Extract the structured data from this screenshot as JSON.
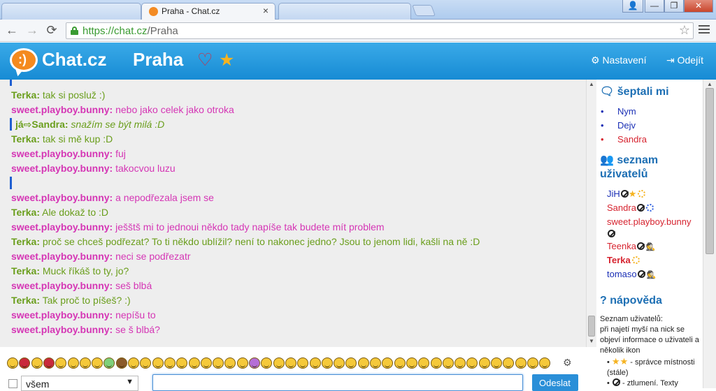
{
  "browser": {
    "tab_title": "Praha - Chat.cz",
    "tab_close": "×",
    "url_scheme": "https://",
    "url_host": "chat.cz",
    "url_path": "/Praha",
    "back": "←",
    "forward": "→",
    "reload": "⟳",
    "bookmark_star": "☆",
    "win_user": "👤",
    "win_min": "—",
    "win_max": "❐",
    "win_close": "✕"
  },
  "header": {
    "logo_face": ":)",
    "brand": "Chat.cz",
    "room": "Praha",
    "heart": "♡",
    "star": "★",
    "settings": "⚙ Nastavení",
    "logout": "⇥ Odejít"
  },
  "messages": [
    {
      "nick": "Terka:",
      "text": "tak si posluž :)",
      "color": "#6a9e1c"
    },
    {
      "nick": "sweet.playboy.bunny:",
      "text": "nebo jako celek jako otroka",
      "color": "#d536b5"
    },
    {
      "nick": "já⇨Sandra:",
      "text": "snažím se být milá :D",
      "color": "#6a9e1c",
      "whisper": true
    },
    {
      "nick": "Terka:",
      "text": "tak si mě kup :D",
      "color": "#6a9e1c"
    },
    {
      "nick": "sweet.playboy.bunny:",
      "text": "fuj",
      "color": "#d536b5"
    },
    {
      "nick": "sweet.playboy.bunny:",
      "text": "takocvou luzu",
      "color": "#d536b5"
    },
    {
      "nick": "",
      "text": "",
      "color": "#6a9e1c"
    },
    {
      "nick": "sweet.playboy.bunny:",
      "text": "a nepodřezala jsem se",
      "color": "#d536b5"
    },
    {
      "nick": "Terka:",
      "text": "Ale dokaž to :D",
      "color": "#6a9e1c"
    },
    {
      "nick": "sweet.playboy.bunny:",
      "text": "ješštš mi to jednoui někdo tady napíše tak budete mít problem",
      "color": "#d536b5"
    },
    {
      "nick": "Terka:",
      "text": "proč se chceš podřezat? To ti někdo ublížil? není to nakonec jedno? Jsou to jenom lidi, kašli na ně :D",
      "color": "#6a9e1c"
    },
    {
      "nick": "sweet.playboy.bunny:",
      "text": "neci se podřezatr",
      "color": "#d536b5"
    },
    {
      "nick": "Terka:",
      "text": "Muck říkáš to ty, jo?",
      "color": "#6a9e1c"
    },
    {
      "nick": "sweet.playboy.bunny:",
      "text": "seš blbá",
      "color": "#d536b5"
    },
    {
      "nick": "Terka:",
      "text": "Tak proč to píšeš? :)",
      "color": "#6a9e1c"
    },
    {
      "nick": "sweet.playboy.bunny:",
      "text": "nepíšu to",
      "color": "#d536b5"
    },
    {
      "nick": "sweet.playboy.bunny:",
      "text": "se š blbá?",
      "color": "#d536b5"
    }
  ],
  "sidebar": {
    "whispered_title": "šeptali mi",
    "whispered": [
      {
        "name": "Nym",
        "color": "#1a2fb5",
        "dot": "#1a2fb5"
      },
      {
        "name": "Dejv",
        "color": "#1a2fb5",
        "dot": "#1a2fb5"
      },
      {
        "name": "Sandra",
        "color": "#d6232f",
        "dot": "#d6232f"
      }
    ],
    "users_title_1": "seznam",
    "users_title_2": "uživatelů",
    "users": [
      {
        "name": "JiH",
        "color": "#1a2fb5"
      },
      {
        "name": "Sandra",
        "color": "#d6232f"
      },
      {
        "name": "sweet.playboy.bunny",
        "color": "#d6232f"
      },
      {
        "name": "Teenka",
        "color": "#d6232f"
      },
      {
        "name": "Terka",
        "color": "#d6232f"
      },
      {
        "name": "tomaso",
        "color": "#1a2fb5"
      }
    ],
    "help_title": "nápověda",
    "help_text_1": "Seznam uživatelů:",
    "help_text_2": "při najetí myší na nick se objeví informace o uživateli a několik ikon",
    "help_item_1": "- správce místnosti (stále)",
    "help_item_2": "- ztlumení. Texty"
  },
  "composer": {
    "recipient": "všem",
    "dropdown": "▼",
    "send": "Odeslat",
    "gear": "⚙"
  }
}
